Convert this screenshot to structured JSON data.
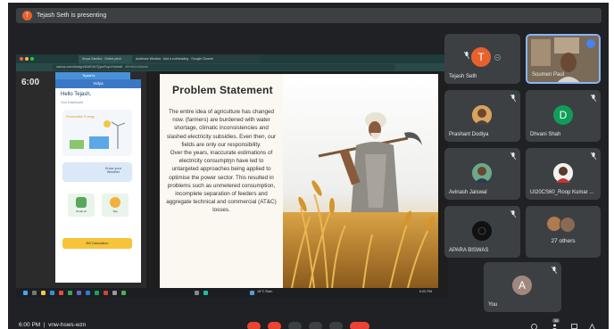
{
  "banner": {
    "initial": "T",
    "text": "Tejash Seth is presenting"
  },
  "browser": {
    "tabs": [
      "Surya Sandha · Online pitch",
      "Audience Window · Add a subheading · Google Chrome"
    ],
    "url": "canva.com/design/DAE0b?Qpn/Sq/cYsi/edit",
    "tab_extra": "4fhhifuhl3blank"
  },
  "app": {
    "time": "6:00",
    "window_title": "Tejash's",
    "header": "Vidya",
    "greeting": "Hello Tejash,",
    "greeting_sub": "Your Dashboard",
    "renewable": "Renewable Energy",
    "know_weather": "Know your Weather",
    "tile1": "Smart AI",
    "tile2": "Tips",
    "cta": "Bill Calculation"
  },
  "slide": {
    "title": "Problem Statement",
    "body": "The entire idea of agriculture has changed now. (farmers) are burdened with water shortage, climatic inconsistencies and slashed electricity subsidies. Even then, our fields are only our responsibility.\nOver the years, inaccurate estimations of electricity consumptῃn have led to untargeted approaches being applied to optimise the power sector. This resulted in problems such as unmetered consumption, incomplete separation of feeders and aggregate technical and commercial (AT&C) losses."
  },
  "taskbar": {
    "weather": "18°C Rain",
    "clock": "6:00 PM"
  },
  "participants": [
    {
      "name": "Tejash Seth",
      "initial": "T",
      "color": "#e8612c"
    },
    {
      "name": "Soumen Paul"
    },
    {
      "name": "Prashant Dodiya"
    },
    {
      "name": "Dhvani Shah",
      "initial": "D",
      "color": "#0f9d58"
    },
    {
      "name": "Avinash Jaiswal"
    },
    {
      "name": "UI20CS60_Roop Kumar ..."
    },
    {
      "name": "APARA BISWAS"
    },
    {
      "name": "27 others"
    },
    {
      "name": "You",
      "initial": "A",
      "color": "#a1887f"
    }
  ],
  "bottom": {
    "clock": "6:00 PM",
    "meeting_code": "vnw-hsws-wzn",
    "badge": "36"
  },
  "colors": {
    "background": "#202124",
    "tile": "#3c4043",
    "hangup": "#ea4335",
    "active_border": "#8ab4f8"
  }
}
